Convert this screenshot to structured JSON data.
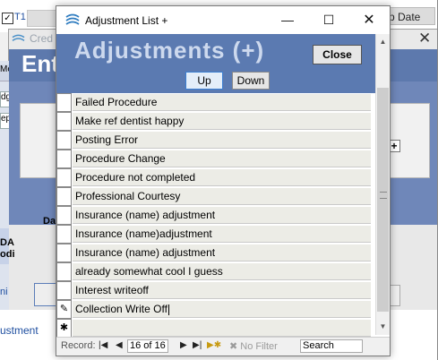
{
  "background": {
    "t1_label": "T1",
    "col_header": "mp Date",
    "credit_title": "Cred",
    "ent_text": "Ent",
    "me_stub": "Me",
    "dg_stub": "dg",
    "ep_stub": "epo",
    "da_label": "Da",
    "ge_label_top": "DA",
    "ge_label_bottom": "odi",
    "ni_stub": "ni",
    "bottom_link": "ustment"
  },
  "window": {
    "title": "Adjustment List +",
    "minimize_glyph": "—",
    "maximize_glyph": "☐",
    "close_glyph": "✕"
  },
  "header": {
    "title": "Adjustments (+)",
    "close_label": "Close",
    "up_label": "Up",
    "down_label": "Down"
  },
  "rows": [
    {
      "text": "Failed Procedure",
      "selector": ""
    },
    {
      "text": "Make ref dentist happy",
      "selector": ""
    },
    {
      "text": "Posting Error",
      "selector": ""
    },
    {
      "text": "Procedure Change",
      "selector": ""
    },
    {
      "text": "Procedure not completed",
      "selector": ""
    },
    {
      "text": "Professional Courtesy",
      "selector": ""
    },
    {
      "text": "Insurance (name) adjustment",
      "selector": ""
    },
    {
      "text": "Insurance (name)adjustment",
      "selector": ""
    },
    {
      "text": "Insurance (name) adjustment",
      "selector": ""
    },
    {
      "text": "already somewhat cool I guess",
      "selector": ""
    },
    {
      "text": "Interest writeoff",
      "selector": ""
    },
    {
      "text": "Collection Write Off",
      "selector": "✎"
    },
    {
      "text": "",
      "selector": "✱"
    }
  ],
  "navigation": {
    "record_label": "Record:",
    "first_glyph": "|◀",
    "prev_glyph": "◀",
    "position": "16 of 16",
    "next_glyph": "▶",
    "last_glyph": "▶|",
    "new_glyph": "▶✱",
    "filter_label": "No Filter",
    "filter_icon_glyph": "✖",
    "search_placeholder": "Search"
  },
  "scrollbar": {
    "up_glyph": "▲",
    "down_glyph": "▼",
    "grip_glyph": "≡"
  },
  "colors": {
    "header_bg": "#5b7ab1",
    "header_text": "#cdd9ee",
    "row_bg": "#ecece6",
    "accent": "#3c7fd1"
  }
}
